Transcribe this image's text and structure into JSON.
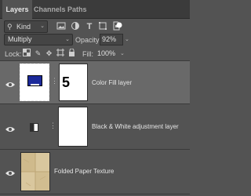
{
  "tabs": [
    {
      "label": "Layers",
      "active": true
    },
    {
      "label": "Channels",
      "active": false
    },
    {
      "label": "Paths",
      "active": false
    }
  ],
  "filter": {
    "kind_label": "Kind",
    "filter_icons": [
      "image-filter-icon",
      "adjustment-filter-icon",
      "type-filter-icon",
      "shape-filter-icon",
      "smart-object-filter-icon",
      "filter-toggle-icon"
    ]
  },
  "blend": {
    "mode": "Multiply",
    "opacity_label": "Opacity:",
    "opacity_value": "92%"
  },
  "lock": {
    "label": "Lock:",
    "icons": [
      "lock-transparent-pixels-icon",
      "lock-image-pixels-icon",
      "lock-position-icon",
      "lock-artboard-icon",
      "lock-all-icon"
    ],
    "fill_label": "Fill:",
    "fill_value": "100%"
  },
  "layers": [
    {
      "name": "Color Fill  layer",
      "selected": true,
      "swatch_color": "#1c2a9a",
      "mask_label": "5"
    },
    {
      "name": "Black & White adjustment layer",
      "selected": false
    },
    {
      "name": "Folded Paper Texture",
      "selected": false
    }
  ],
  "colors": {
    "panel_bg": "#535353",
    "selected_row": "#696969",
    "color_fill": "#1c2a9a"
  }
}
